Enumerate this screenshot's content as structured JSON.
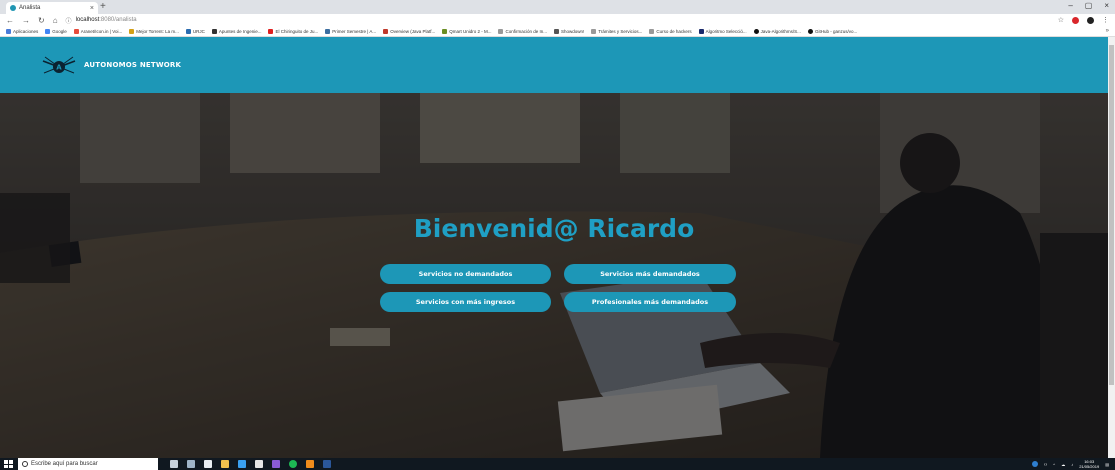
{
  "browser": {
    "tab_title": "Analista",
    "tab_close": "×",
    "new_tab": "+",
    "window_controls": [
      "–",
      "▢",
      "×"
    ],
    "url_host": "localhost",
    "url_path": ":8080/analista",
    "bookmarks": [
      "Aplicaciones",
      "Google",
      "Aranet/Icon.in | Voi...",
      "Mejor Torrent: La m...",
      "URJC",
      "Apuntes de Ingenie...",
      "El Chiringuito de Ju...",
      "Primer Semestre | A...",
      "Overview (Java Platf...",
      "Qmart Unidro 2 - M...",
      "Confirmación de In...",
      "Showdown!",
      "Trámites y Servicios...",
      "Curso de hackers",
      "Algoritmo Selecció...",
      "Java-Algorithms/S...",
      "GitHub - ganzus/vo..."
    ],
    "bookmarks_more": "»"
  },
  "navbar": {
    "brand": "AUTONOMOS NETWORK"
  },
  "hero": {
    "welcome": "Bienvenid@ Ricardo",
    "buttons": {
      "no_demandados": "Servicios no demandados",
      "mas_demandados": "Servicios más demandados",
      "mas_ingresos": "Servicios con más ingresos",
      "profesionales": "Profesionales más demandados"
    }
  },
  "taskbar": {
    "search_placeholder": "Escribe aquí para buscar",
    "time": "16:03",
    "date": "21/05/2019"
  },
  "colors": {
    "brand": "#1d97b7",
    "heading": "#1f9fc4"
  }
}
